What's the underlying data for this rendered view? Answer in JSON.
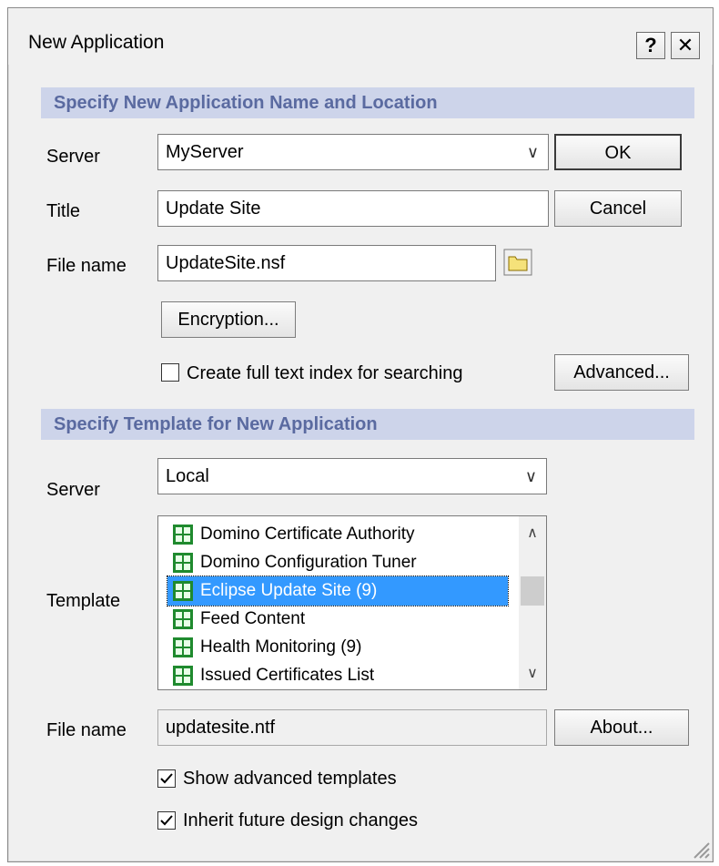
{
  "window": {
    "title": "New Application"
  },
  "titlebar": {
    "help_icon": "?",
    "close_icon": "✕"
  },
  "section1": {
    "title": "Specify New Application Name and Location"
  },
  "server": {
    "label": "Server",
    "value": "MyServer"
  },
  "title_field": {
    "label": "Title",
    "value": "Update Site"
  },
  "filename": {
    "label": "File name",
    "value": "UpdateSite.nsf"
  },
  "buttons": {
    "ok": "OK",
    "cancel": "Cancel",
    "encryption": "Encryption...",
    "advanced": "Advanced...",
    "about": "About..."
  },
  "fulltext": {
    "label": "Create full text index for searching",
    "checked": false
  },
  "section2": {
    "title": "Specify Template for New Application"
  },
  "template_server": {
    "label": "Server",
    "value": "Local"
  },
  "template": {
    "label": "Template",
    "items": [
      "Domino Certificate Authority",
      "Domino Configuration Tuner",
      "Eclipse Update Site (9)",
      "Feed Content",
      "Health Monitoring (9)",
      "Issued Certificates List"
    ],
    "selected_index": 2
  },
  "template_file": {
    "label": "File name",
    "value": "updatesite.ntf"
  },
  "options": {
    "show_advanced": {
      "label": "Show advanced templates",
      "checked": true
    },
    "inherit": {
      "label": "Inherit future design changes",
      "checked": true
    }
  },
  "colors": {
    "section_bg": "#cdd4ea",
    "section_text": "#5a6aa0",
    "selection": "#3399ff",
    "icon_green": "#1f8a2e"
  }
}
